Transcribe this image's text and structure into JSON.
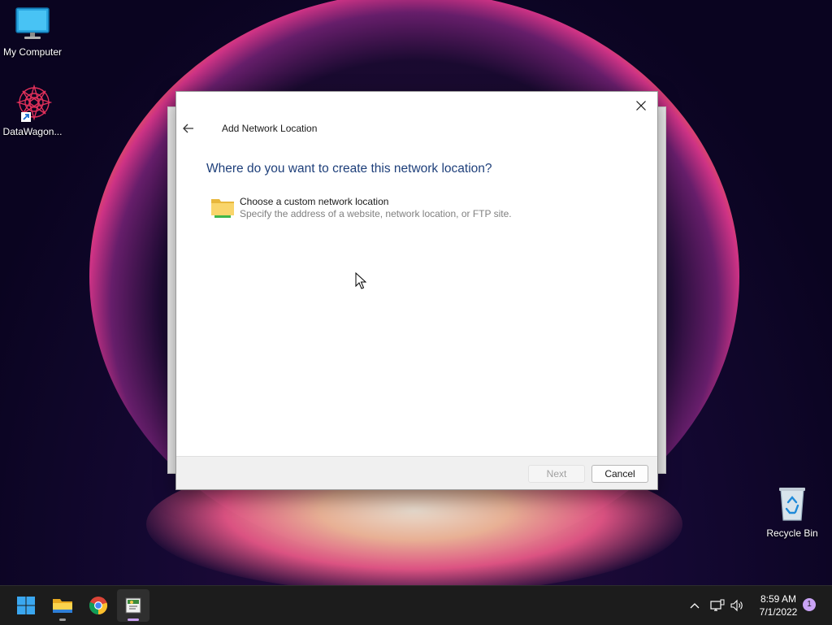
{
  "desktop": {
    "icons": [
      {
        "label": "My Computer"
      },
      {
        "label": "DataWagon..."
      },
      {
        "label": "Recycle Bin"
      }
    ]
  },
  "dialog": {
    "title": "Add Network Location",
    "question": "Where do you want to create this network location?",
    "option": {
      "title": "Choose a custom network location",
      "description": "Specify the address of a website, network location, or FTP site."
    },
    "next_label": "Next",
    "cancel_label": "Cancel"
  },
  "taskbar": {
    "apps": [
      "start-icon",
      "file-explorer-icon",
      "chrome-icon",
      "network-wizard-icon"
    ],
    "time": "8:59 AM",
    "date": "7/1/2022",
    "notification_count": "1"
  },
  "colors": {
    "accent": "#1e3f7a",
    "taskbar": "#1c1c1c",
    "notification_badge": "#c9a3f5"
  }
}
